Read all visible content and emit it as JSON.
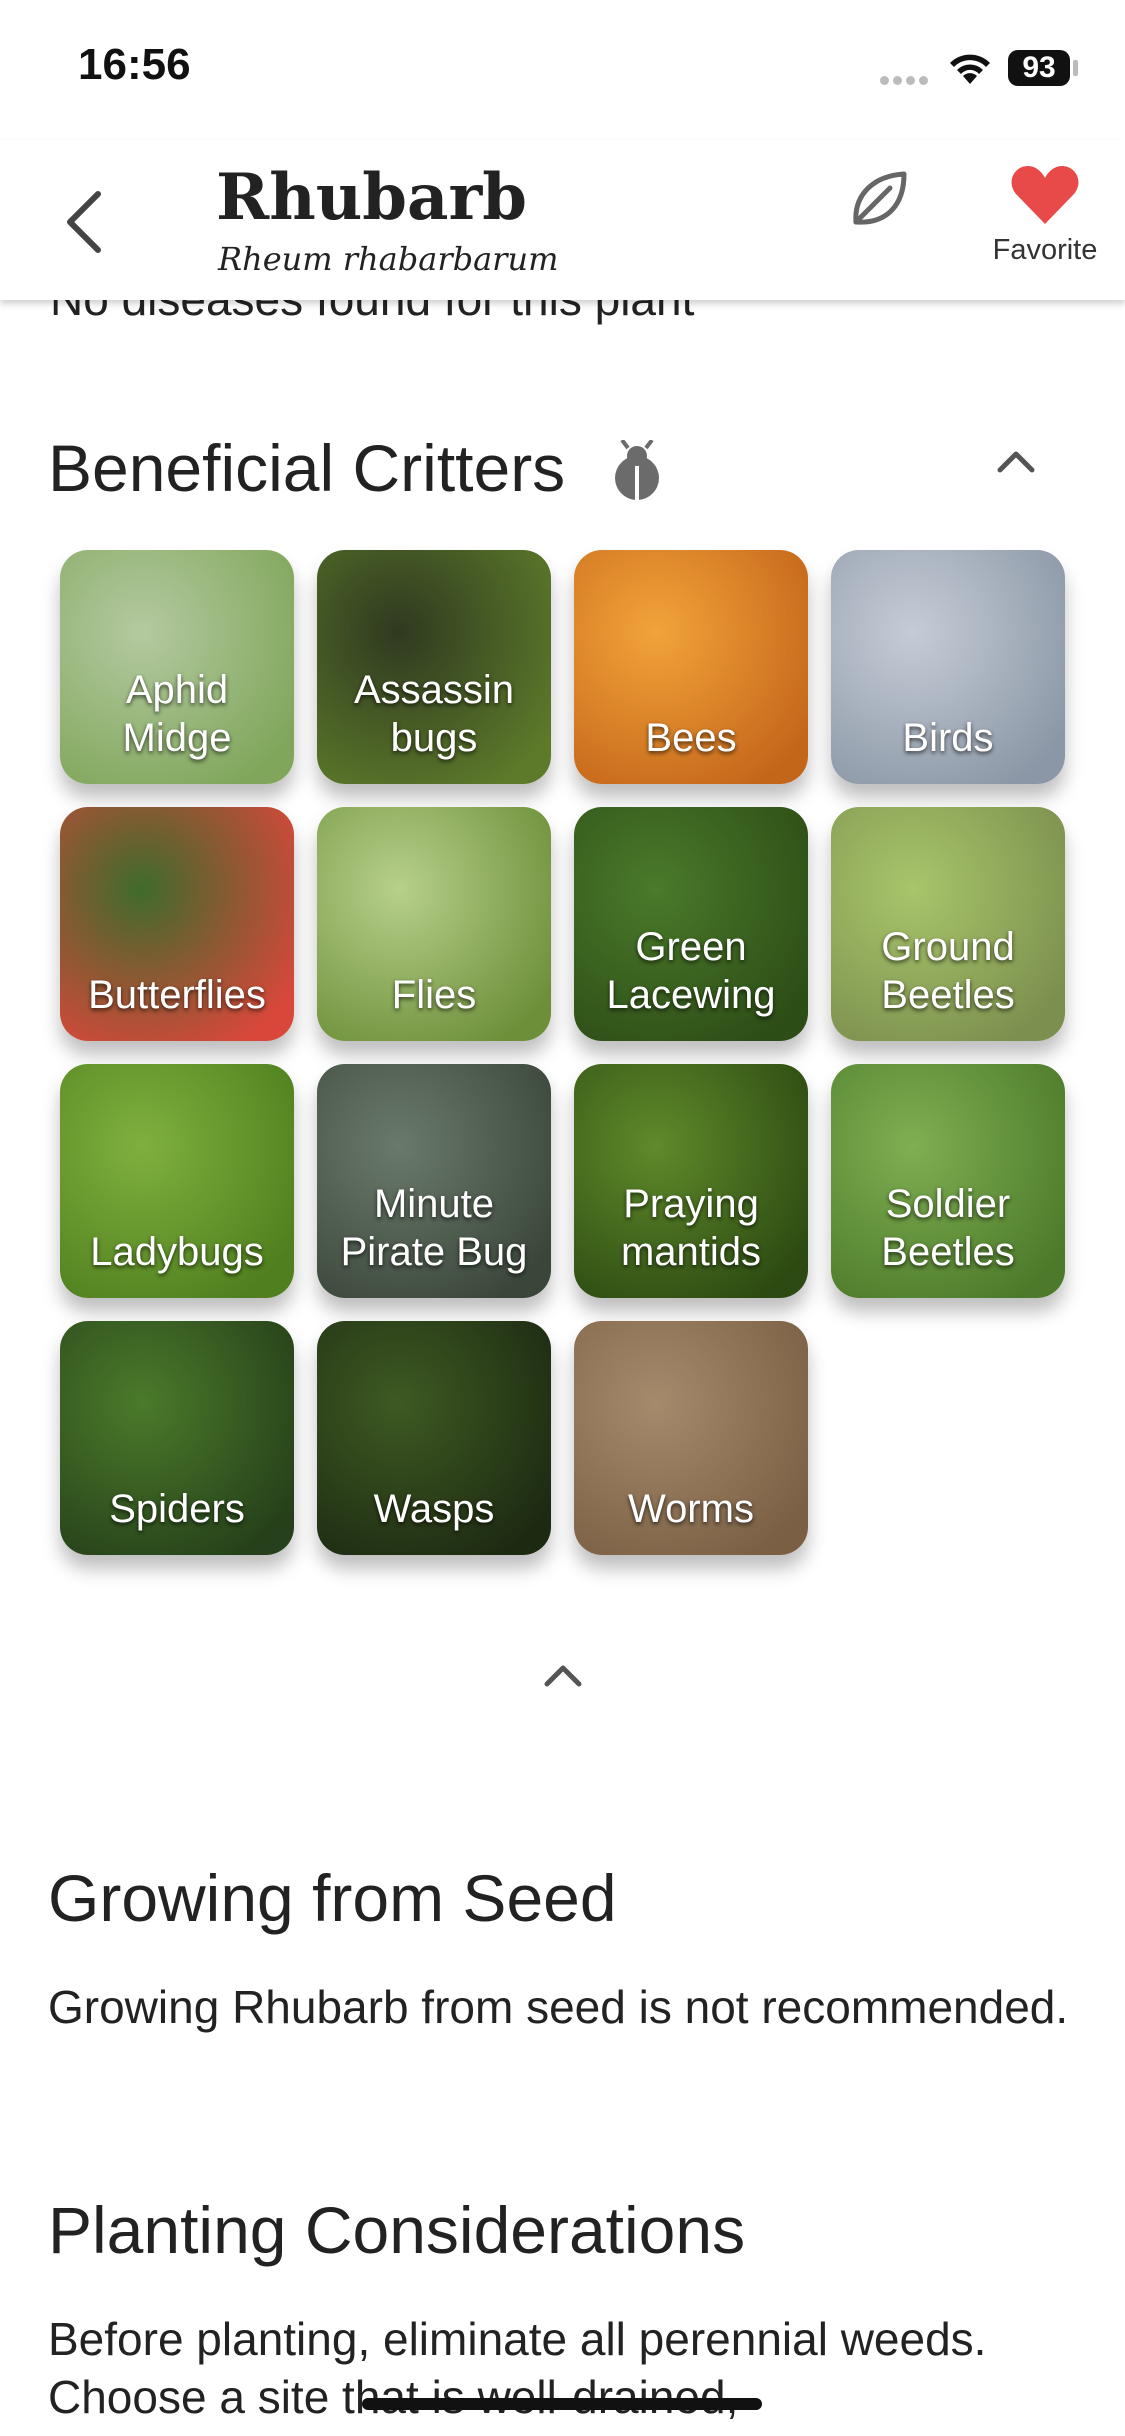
{
  "status": {
    "time": "16:56",
    "battery": "93"
  },
  "header": {
    "title": "Rhubarb",
    "subtitle": "Rheum rhabarbarum",
    "favorite_label": "Favorite",
    "accent": "#e84a4a"
  },
  "diseases_text": "No diseases found for this plant",
  "critters": {
    "heading": "Beneficial Critters",
    "items": [
      {
        "label": "Aphid Midge",
        "colors": [
          "#b4c9a0",
          "#7fa65a"
        ]
      },
      {
        "label": "Assassin bugs",
        "colors": [
          "#2f3a20",
          "#5d7a2a"
        ]
      },
      {
        "label": "Bees",
        "colors": [
          "#f2a33a",
          "#c4661a"
        ]
      },
      {
        "label": "Birds",
        "colors": [
          "#c5ccd6",
          "#8b97a6"
        ]
      },
      {
        "label": "Butterflies",
        "colors": [
          "#3f6b2c",
          "#d9473a"
        ]
      },
      {
        "label": "Flies",
        "colors": [
          "#b7d08a",
          "#6d8f3a"
        ]
      },
      {
        "label": "Green Lacewing",
        "colors": [
          "#4a7a2a",
          "#2d4d17"
        ]
      },
      {
        "label": "Ground Beetles",
        "colors": [
          "#a8c56a",
          "#7b8f4e"
        ]
      },
      {
        "label": "Ladybugs",
        "colors": [
          "#7fb03e",
          "#4f7f1e"
        ]
      },
      {
        "label": "Minute Pirate Bug",
        "colors": [
          "#6a7a6a",
          "#3a463a"
        ]
      },
      {
        "label": "Praying mantids",
        "colors": [
          "#5f8a2a",
          "#2c4a12"
        ]
      },
      {
        "label": "Soldier Beetles",
        "colors": [
          "#7fae52",
          "#4c7a2a"
        ]
      },
      {
        "label": "Spiders",
        "colors": [
          "#4b7a2a",
          "#25401a"
        ]
      },
      {
        "label": "Wasps",
        "colors": [
          "#3e5a22",
          "#1d2a12"
        ]
      },
      {
        "label": "Worms",
        "colors": [
          "#a68a6c",
          "#7a5f44"
        ]
      }
    ]
  },
  "growing": {
    "heading": "Growing from Seed",
    "text": "Growing Rhubarb from seed is not recommended."
  },
  "planting": {
    "heading": "Planting Considerations",
    "text": "Before planting, eliminate all perennial weeds. Choose a site that is well-drained,"
  }
}
